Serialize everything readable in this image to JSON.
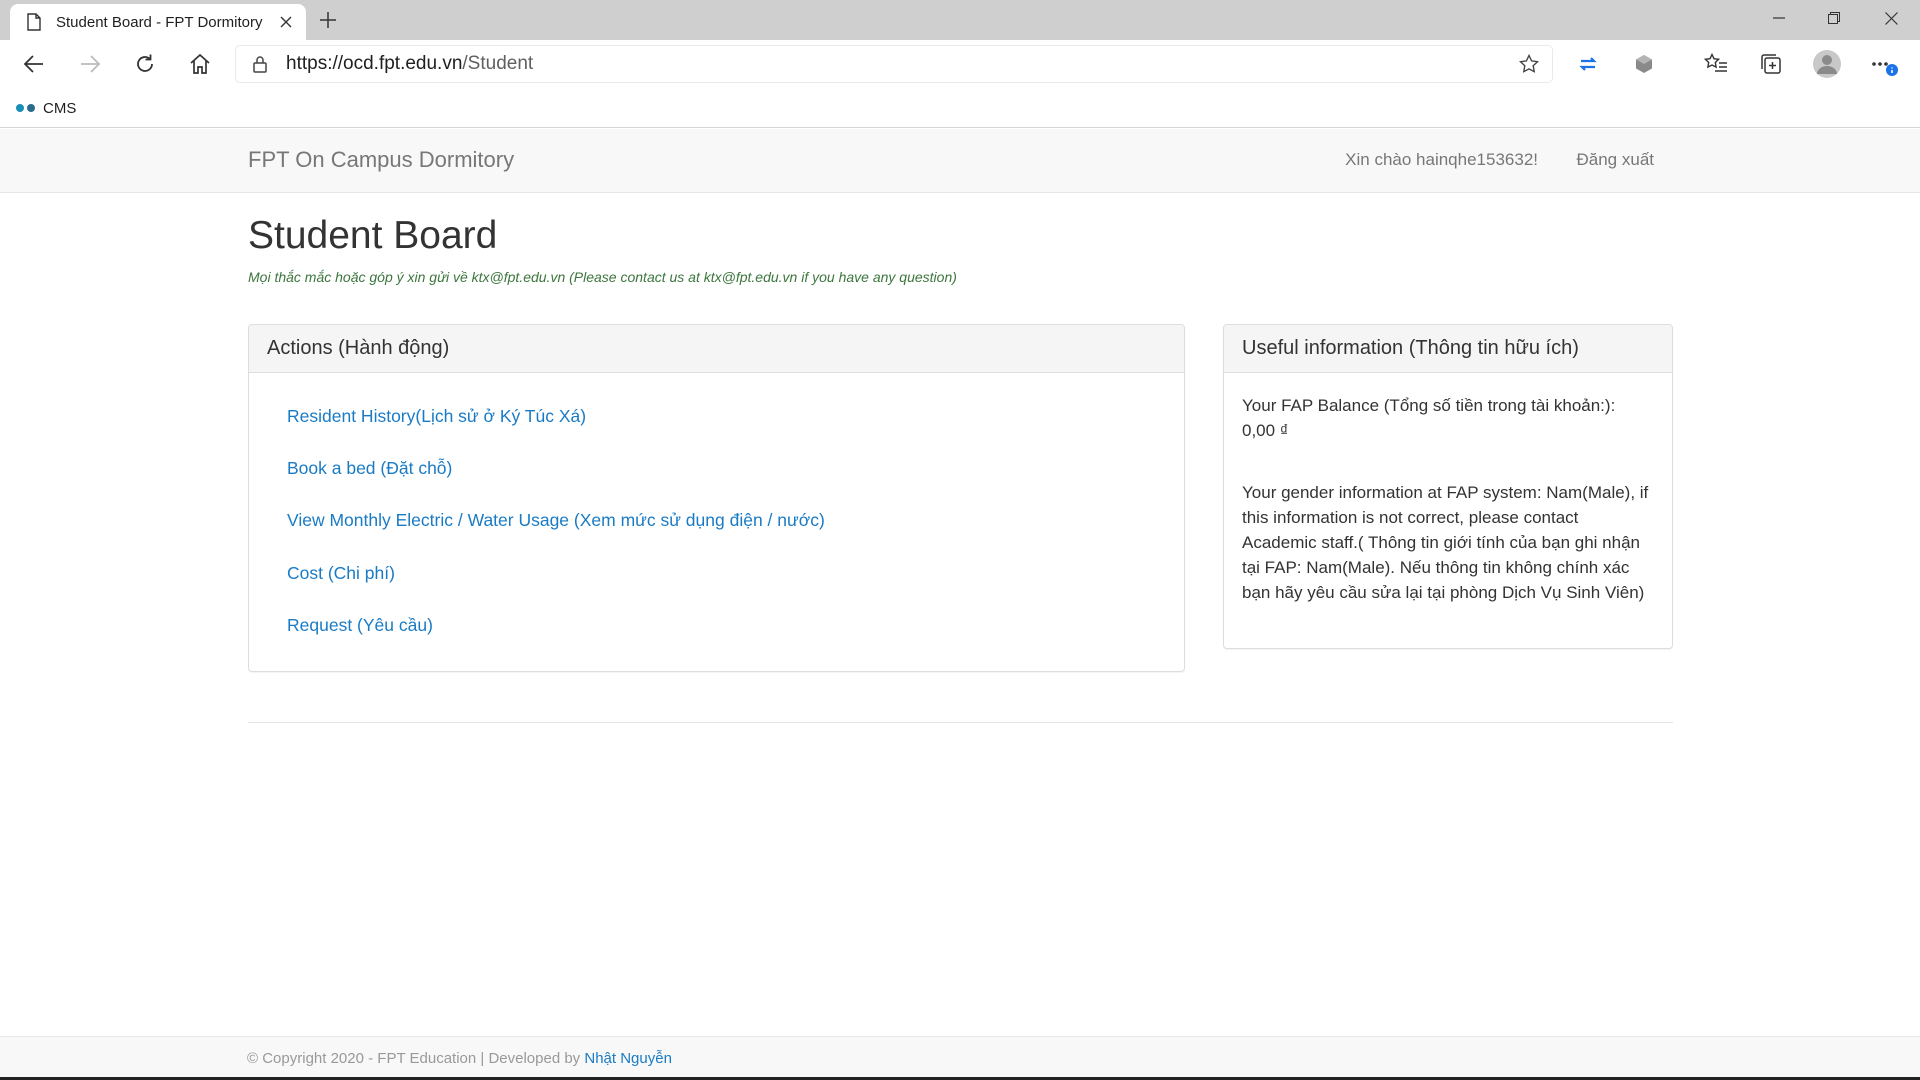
{
  "browser": {
    "tab_title": "Student Board - FPT Dormitory",
    "url_host": "https://ocd.fpt.edu.vn",
    "url_path": "/Student",
    "bookmark_label": "CMS",
    "bookmark_colors": [
      "#1a8fb5",
      "#2a6b8f"
    ],
    "accent": "#1a73e8"
  },
  "navbar": {
    "brand": "FPT On Campus Dormitory",
    "greeting": "Xin chào hainqhe153632!",
    "logout": "Đăng xuất"
  },
  "page": {
    "title": "Student Board",
    "contact_note": "Mọi thắc mắc hoặc góp ý xin gửi về ktx@fpt.edu.vn (Please contact us at ktx@fpt.edu.vn if you have any question)"
  },
  "actions": {
    "heading": "Actions (Hành động)",
    "items": [
      "Resident History(Lịch sử ở Ký Túc Xá)",
      "Book a bed (Đặt chỗ)",
      "View Monthly Electric / Water Usage (Xem mức sử dụng điện / nước)",
      "Cost (Chi phí)",
      "Request (Yêu cầu)"
    ]
  },
  "info": {
    "heading": "Useful information (Thông tin hữu ích)",
    "balance_line1": "Your FAP Balance (Tổng số tiền trong tài khoản:):",
    "balance_value": "0,00 ₫",
    "gender_text": "Your gender information at FAP system: Nam(Male), if this information is not correct, please contact Academic staff.( Thông tin giới tính của bạn ghi nhận tại FAP: Nam(Male). Nếu thông tin không chính xác bạn hãy yêu cầu sửa lại tại phòng Dịch Vụ Sinh Viên)"
  },
  "footer": {
    "copyright": "© Copyright 2020 - FPT Education | Developed by ",
    "developer": "Nhật Nguyễn"
  },
  "colors": {
    "link": "#1a7bc5",
    "note_green": "#3c763d",
    "notification_badge": "#1a73e8"
  }
}
